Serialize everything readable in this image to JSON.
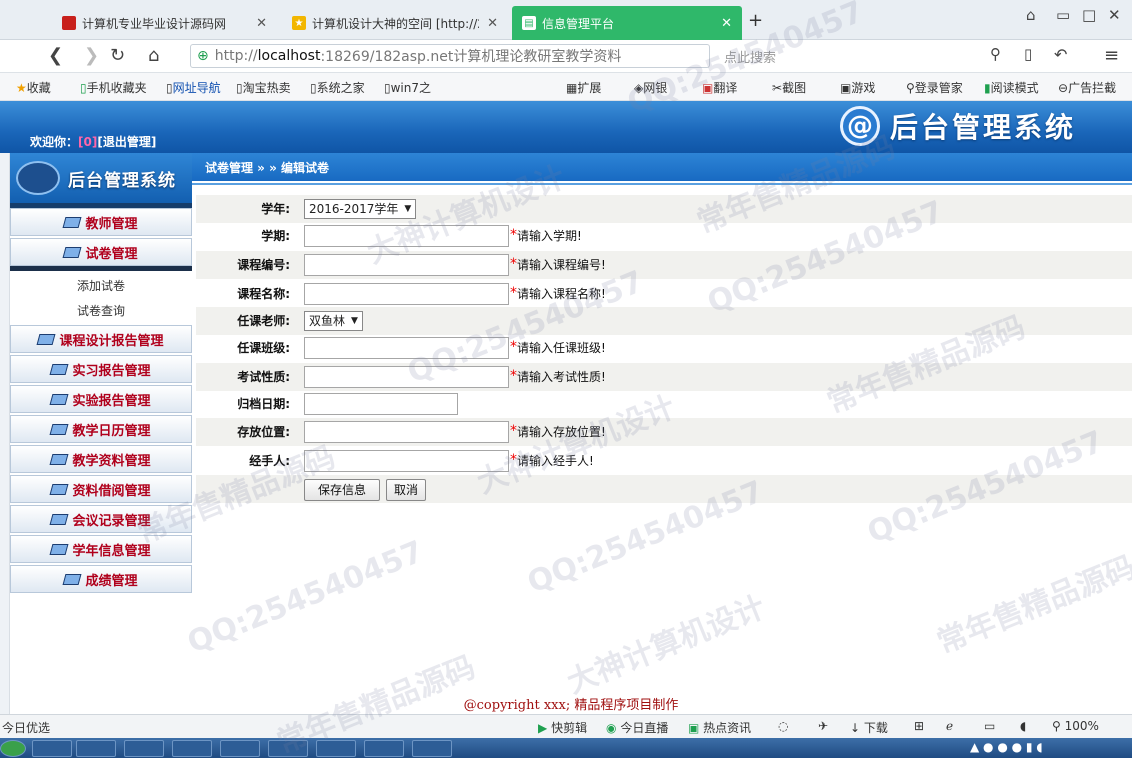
{
  "browser": {
    "tabs": [
      {
        "title": "计算机专业毕业设计源码网",
        "active": false
      },
      {
        "title": "计算机设计大神的空间 [http://2",
        "active": false
      },
      {
        "title": "信息管理平台",
        "active": true
      }
    ],
    "new_tab": "+",
    "url_prefix": "http://",
    "url_host": "localhost",
    "url_rest": ":18269/182asp.net计算机理论教研室教学资料",
    "search_placeholder": "点此搜索",
    "bookmarks_left": [
      "收藏",
      "手机收藏夹",
      "网址导航",
      "淘宝热卖",
      "系统之家",
      "win7之"
    ],
    "bookmarks_right": [
      "扩展",
      "网银",
      "翻译",
      "截图",
      "游戏",
      "登录管家",
      "阅读模式",
      "广告拦截"
    ]
  },
  "header": {
    "welcome_label": "欢迎你：",
    "welcome_user": "[0]",
    "logout": "[退出管理]",
    "brand_symbol": "@",
    "brand_title": "后台管理系统"
  },
  "sidebar": {
    "brand_title": "后台管理系统",
    "menus_top": [
      "教师管理",
      "试卷管理"
    ],
    "submenu": [
      "添加试卷",
      "试卷查询"
    ],
    "menus_bottom": [
      "课程设计报告管理",
      "实习报告管理",
      "实验报告管理",
      "教学日历管理",
      "教学资料管理",
      "资料借阅管理",
      "会议记录管理",
      "学年信息管理",
      "成绩管理"
    ]
  },
  "breadcrumb": "试卷管理 » » 编辑试卷",
  "form": {
    "year_label": "学年:",
    "year_value": "2016-2017学年",
    "semester_label": "学期:",
    "semester_hint": "请输入学期!",
    "course_no_label": "课程编号:",
    "course_no_hint": "请输入课程编号!",
    "course_name_label": "课程名称:",
    "course_name_hint": "请输入课程名称!",
    "teacher_label": "任课老师:",
    "teacher_value": "双鱼林",
    "class_label": "任课班级:",
    "class_hint": "请输入任课班级!",
    "exam_type_label": "考试性质:",
    "exam_type_hint": "请输入考试性质!",
    "archive_date_label": "归档日期:",
    "location_label": "存放位置:",
    "location_hint": "请输入存放位置!",
    "handler_label": "经手人:",
    "handler_hint": "请输入经手人!",
    "save_button": "保存信息",
    "cancel_button": "取消",
    "required_mark": "*"
  },
  "footer": {
    "copyright": "@copyright xxx; 精品程序项目制作"
  },
  "statusbar": {
    "left": "今日优选",
    "items": [
      "快剪辑",
      "今日直播",
      "热点资讯",
      "下载"
    ],
    "zoom": "100%"
  },
  "watermarks": [
    "QQ:254540457",
    "常年售精品源码",
    "大神计算机设计"
  ]
}
